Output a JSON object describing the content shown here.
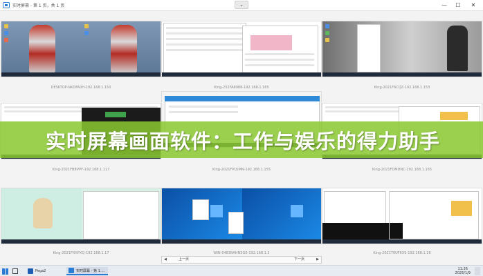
{
  "window": {
    "title": "实时屏幕 - 第 1 页，共 1 页",
    "collapse_glyph": "⌄",
    "min_glyph": "—",
    "max_glyph": "☐",
    "close_glyph": "✕"
  },
  "tiles": [
    {
      "caption": "DESKTOP-NKDFA0H-192.168.1.150"
    },
    {
      "caption": "King-252FA8988-192.168.1.165"
    },
    {
      "caption": "King-2021F6CQZ-192.168.1.153"
    },
    {
      "caption": "King-2021FB8VPF-192.168.1.117"
    },
    {
      "caption": "King-2021FPLUMN-192.168.1.155"
    },
    {
      "caption": "King-2021FDMDNC-192.168.1.165"
    },
    {
      "caption": "King-2021FRXPXQ-192.168.1.17"
    },
    {
      "caption": "WIN-0483RAHN3G0-192.168.1.3"
    },
    {
      "caption": "King-2021T0UF6XS-192.168.1.16"
    }
  ],
  "banner": {
    "text": "实时屏幕画面软件：工作与娱乐的得力助手"
  },
  "pager": {
    "prev": "上一页",
    "next": "下一页",
    "prev_arrow": "◀",
    "next_arrow": "▶"
  },
  "taskbar": {
    "search_label": "Pega2",
    "app_label": "实时屏幕 - 第 1 ...",
    "time": "11:26",
    "date": "2025/1/9"
  },
  "colors": {
    "banner": "#8ac832",
    "accent": "#2a7bd4"
  }
}
